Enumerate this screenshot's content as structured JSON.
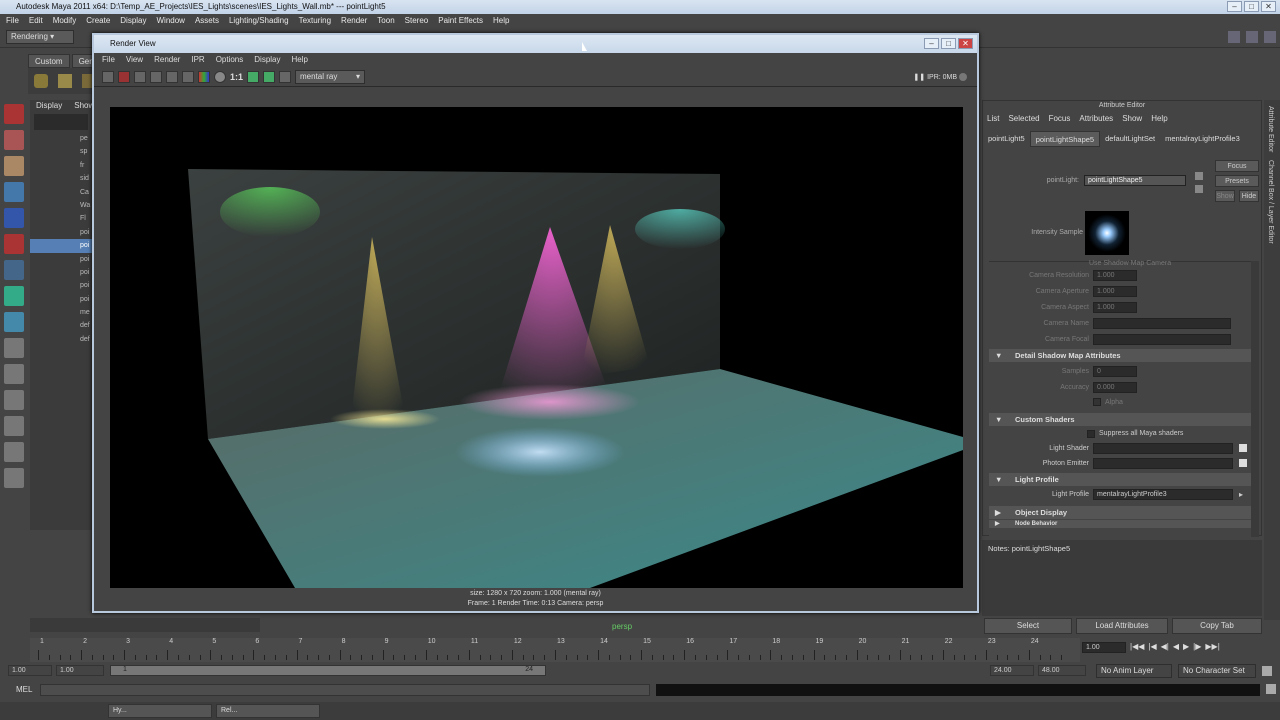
{
  "app": {
    "title": "Autodesk Maya 2011 x64: D:\\Temp_AE_Projects\\IES_Lights\\scenes\\IES_Lights_Wall.mb*   ---   pointLight5",
    "menu": [
      "File",
      "Edit",
      "Modify",
      "Create",
      "Display",
      "Window",
      "Assets",
      "Lighting/Shading",
      "Texturing",
      "Render",
      "Toon",
      "Stereo",
      "Paint Effects",
      "Help"
    ],
    "mode": "Rendering"
  },
  "shelf": {
    "tabs": [
      "Custom",
      "Gene"
    ]
  },
  "outliner": {
    "menu": [
      "Display",
      "Show"
    ],
    "rows": [
      "pe",
      "sp",
      "fr",
      "sid",
      "Ca",
      "Wa",
      "Fl",
      "poi",
      "poi",
      "poi",
      "poi",
      "poi",
      "poi",
      "me",
      "def",
      "def"
    ],
    "selected_index": 8
  },
  "render_view": {
    "title": "Render View",
    "menu": [
      "File",
      "View",
      "Render",
      "IPR",
      "Options",
      "Display",
      "Help"
    ],
    "renderer": "mental ray",
    "ipr": "IPR: 0MB",
    "ratio": "1:1",
    "info_line1": "size: 1280 x 720  zoom: 1.000        (mental ray)",
    "info_line2": "Frame: 1      Render Time: 0:13      Camera: persp"
  },
  "attribute_editor": {
    "title": "Attribute Editor",
    "menu": [
      "List",
      "Selected",
      "Focus",
      "Attributes",
      "Show",
      "Help"
    ],
    "tabs": [
      "pointLight5",
      "pointLightShape5",
      "defaultLightSet",
      "mentalrayLightProfile3"
    ],
    "active_tab": 1,
    "focus_label": "Focus",
    "presets_label": "Presets",
    "show_label": "Show",
    "hide_label": "Hide",
    "node_label": "pointLight:",
    "node_value": "pointLightShape5",
    "intensity_sample": "Intensity Sample",
    "use_depth_label": "Use Shadow Map Camera",
    "camera_fields": [
      {
        "label": "Camera Resolution",
        "value": "1.000"
      },
      {
        "label": "Camera Aperture",
        "value": "1.000"
      },
      {
        "label": "Camera Aspect",
        "value": "1.000"
      },
      {
        "label": "Camera Name",
        "value": ""
      },
      {
        "label": "Camera Focal",
        "value": ""
      }
    ],
    "detail_section": "Detail Shadow Map Attributes",
    "samples_label": "Samples",
    "samples_value": "0",
    "accuracy_label": "Accuracy",
    "accuracy_value": "0.000",
    "alpha_label": "Alpha",
    "custom_shaders": "Custom Shaders",
    "suppress_label": "Suppress all Maya shaders",
    "light_shader_label": "Light Shader",
    "photon_emitter_label": "Photon Emitter",
    "light_profile_section": "Light Profile",
    "light_profile_label": "Light Profile",
    "light_profile_value": "mentalrayLightProfile3",
    "object_display": "Object Display",
    "node_behavior": "Node Behavior",
    "notes_label": "Notes: pointLightShape5",
    "select_btn": "Select",
    "load_btn": "Load Attributes",
    "copy_btn": "Copy Tab"
  },
  "side_tabs": [
    "Attribute Editor",
    "Channel Box / Layer Editor"
  ],
  "timeline": {
    "ticks": [
      "1",
      "2",
      "3",
      "4",
      "5",
      "6",
      "7",
      "8",
      "9",
      "10",
      "11",
      "12",
      "13",
      "14",
      "15",
      "16",
      "17",
      "18",
      "19",
      "20",
      "21",
      "22",
      "23",
      "24"
    ],
    "current": "1.00",
    "start": "1.00",
    "start2": "1.00",
    "range_start": "1",
    "range_end": "24",
    "end": "24.00",
    "end2": "48.00",
    "anim_layer": "No Anim Layer",
    "char_set": "No Character Set",
    "panel_label": "persp"
  },
  "command": {
    "mel": "MEL"
  },
  "taskbar": [
    {
      "label": "Hy..."
    },
    {
      "label": "Rel..."
    }
  ],
  "colors": {
    "accent_select": "#5680b5",
    "bg": "#444444",
    "window_border": "#b9c9dd"
  }
}
